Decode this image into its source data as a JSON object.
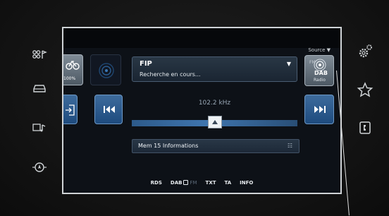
{
  "side_left": {
    "icons": [
      "media-icon",
      "car-icon",
      "phone-audio-icon",
      "navigation-icon"
    ]
  },
  "side_right": {
    "icons": [
      "settings-icon",
      "favorites-icon",
      "phone-icon"
    ]
  },
  "screen": {
    "source_label": "Source ▼",
    "left_tiles": {
      "bike_label": "100%"
    },
    "station": {
      "name": "FIP",
      "status": "Recherche en cours...",
      "dropdown": "▼"
    },
    "frequency": "102.2 kHz",
    "preset": {
      "label": "Mem 15 Informations"
    },
    "dab_tile": {
      "line1": "FM",
      "line2": "DAB",
      "line3": "Radio"
    },
    "status_items": [
      {
        "text": "RDS",
        "state": "on"
      },
      {
        "text": "DAB",
        "state": "on"
      },
      {
        "text": "FM",
        "state": "off"
      },
      {
        "text": "TXT",
        "state": "on"
      },
      {
        "text": "TA",
        "state": "on"
      },
      {
        "text": "INFO",
        "state": "on"
      }
    ]
  },
  "colors": {
    "accent_blue": "#2f63a0",
    "panel": "#1d2938",
    "highlight": "#ffffff"
  }
}
